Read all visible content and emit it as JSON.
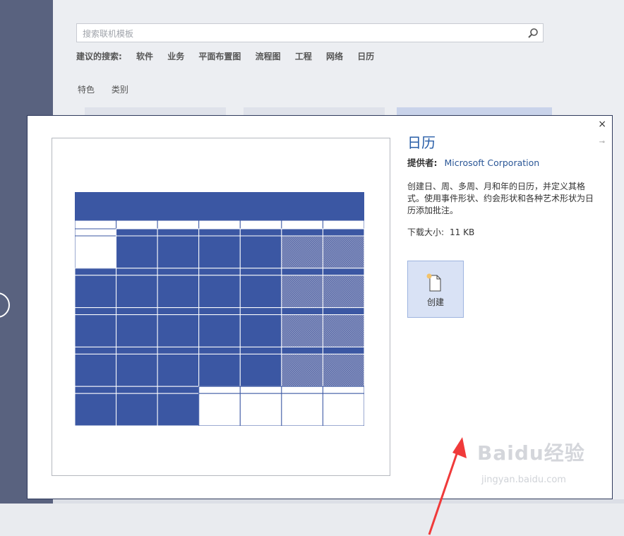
{
  "background": {
    "search": {
      "placeholder": "搜索联机模板"
    },
    "suggestions": {
      "label": "建议的搜索:",
      "items": [
        "软件",
        "业务",
        "平面布置图",
        "流程图",
        "工程",
        "网络",
        "日历"
      ]
    },
    "tabs": [
      "特色",
      "类别"
    ]
  },
  "dialog": {
    "close_label": "×",
    "title": "日历",
    "provider_label": "提供者:",
    "provider_value": "Microsoft Corporation",
    "description": "创建日、周、多周、月和年的日历，并定义其格式。使用事件形状、约会形状和各种艺术形状为日历添加批注。",
    "size_label": "下载大小:",
    "size_value": "11 KB",
    "create_label": "创建"
  },
  "watermark": {
    "main": "Baidu经验",
    "sub": "jingyan.baidu.com"
  },
  "colors": {
    "accent": "#3b57a3",
    "title": "#2a5fa8",
    "arrow": "#f03a3a"
  }
}
